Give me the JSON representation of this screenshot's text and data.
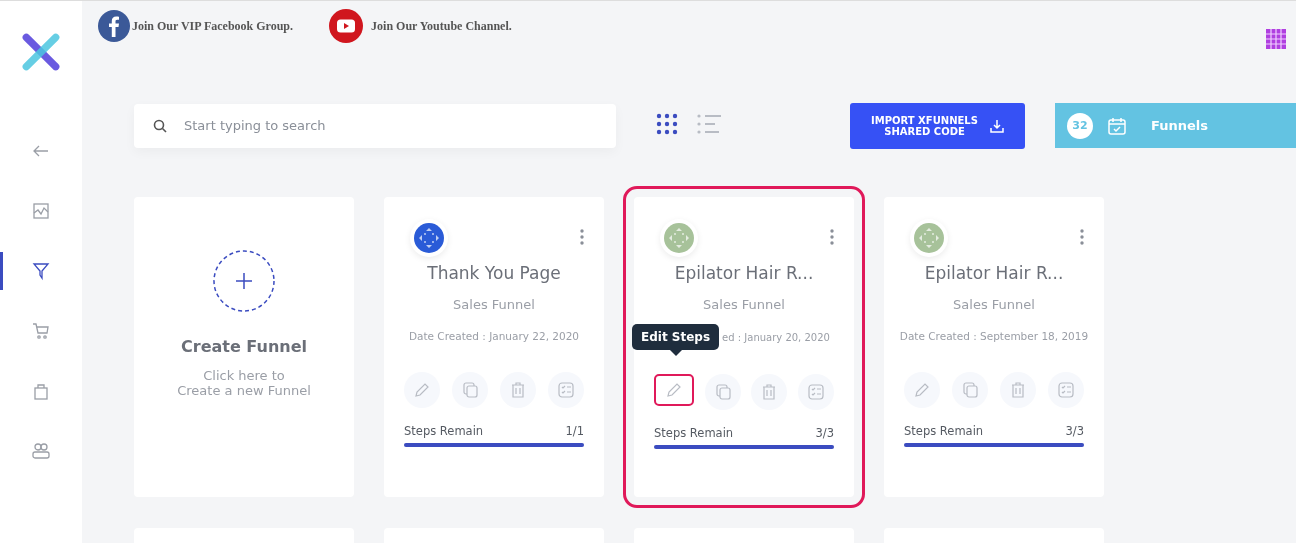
{
  "top_links": [
    {
      "kind": "facebook",
      "label": "Join Our VIP Facebook Group."
    },
    {
      "kind": "youtube",
      "label": "Join Our Youtube Channel."
    }
  ],
  "sidebar": {
    "items": [
      {
        "kind": "back",
        "selected": false
      },
      {
        "kind": "analytics",
        "selected": false
      },
      {
        "kind": "funnel",
        "selected": true
      },
      {
        "kind": "cart",
        "selected": false
      },
      {
        "kind": "bag",
        "selected": false
      },
      {
        "kind": "users",
        "selected": false
      }
    ]
  },
  "search": {
    "placeholder": "Start typing to search"
  },
  "views": [
    {
      "kind": "grid",
      "selected": true
    },
    {
      "kind": "list",
      "selected": false
    }
  ],
  "import_button": {
    "lines": [
      "IMPORT XFUNNELS",
      "SHARED CODE"
    ]
  },
  "funnels_bar": {
    "count": "32",
    "label": "Funnels"
  },
  "create_card": {
    "title": "Create Funnel",
    "subtitle": [
      "Click here to",
      "Create a new Funnel"
    ]
  },
  "cards": [
    {
      "color": "#2a5bd7",
      "title": "Thank You Page",
      "type": "Sales Funnel",
      "date": "Date Created : January 22, 2020",
      "steps_label": "Steps Remain",
      "steps": "1/1",
      "level": 1,
      "highlighted": false
    },
    {
      "color": "#a7c29a",
      "title": "Epilator Hair R...",
      "type": "Sales Funnel",
      "date": "ed : January 20, 2020",
      "steps_label": "Steps Remain",
      "steps": "3/3",
      "level": 1,
      "highlighted": true,
      "tooltip": "Edit Steps"
    },
    {
      "color": "#a7c29a",
      "title": "Epilator Hair R...",
      "type": "Sales Funnel",
      "date": "Date Created : September 18, 2019",
      "steps_label": "Steps Remain",
      "steps": "3/3",
      "level": 1,
      "highlighted": false
    }
  ]
}
